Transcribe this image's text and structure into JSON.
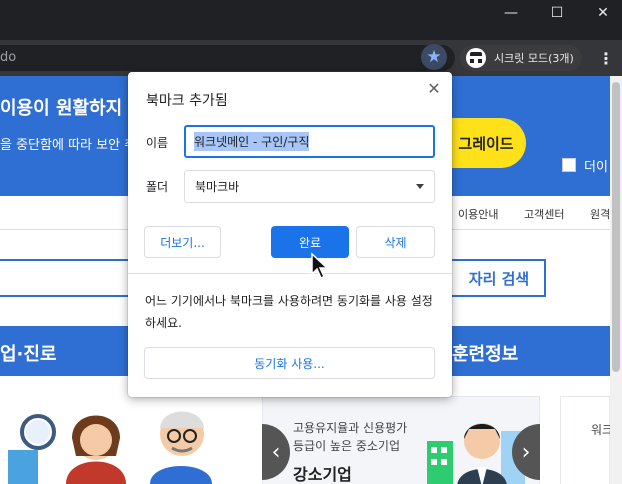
{
  "window": {
    "minimize_glyph": "—",
    "maximize_glyph": "☐",
    "close_glyph": "✕"
  },
  "toolbar": {
    "omnibox_text": "do",
    "star_icon": "★",
    "incognito_label": "시크릿 모드(3개)",
    "menu_icon": "⋮"
  },
  "page": {
    "banner_line1": "이용이 원활하지 않",
    "banner_line2": "을 중단함에 따라 보안 취약",
    "upgrade_label": "그레이드",
    "checkbox_label": "더이",
    "nav_links": [
      "이용안내",
      "고객센터",
      "원격"
    ],
    "search_button": "자리 검색",
    "section_left": "업·진로",
    "section_right": "훈련정보",
    "card_line1": "고용유지율과 신용평가",
    "card_line2": "등급이 높은 중소기업",
    "card_title": "강소기업",
    "card_right_text": "워크",
    "prev_glyph": "‹",
    "next_glyph": "›"
  },
  "bookmark_bubble": {
    "title": "북마크 추가됨",
    "close_glyph": "✕",
    "name_label": "이름",
    "name_value": "워크넷메인 - 구인/구직",
    "folder_label": "폴더",
    "folder_value": "북마크바",
    "more_button": "더보기...",
    "done_button": "완료",
    "remove_button": "삭제",
    "sync_text": "어느 기기에서나 북마크를 사용하려면 동기화를 사용 설정하세요.",
    "sync_button": "동기화 사용..."
  }
}
